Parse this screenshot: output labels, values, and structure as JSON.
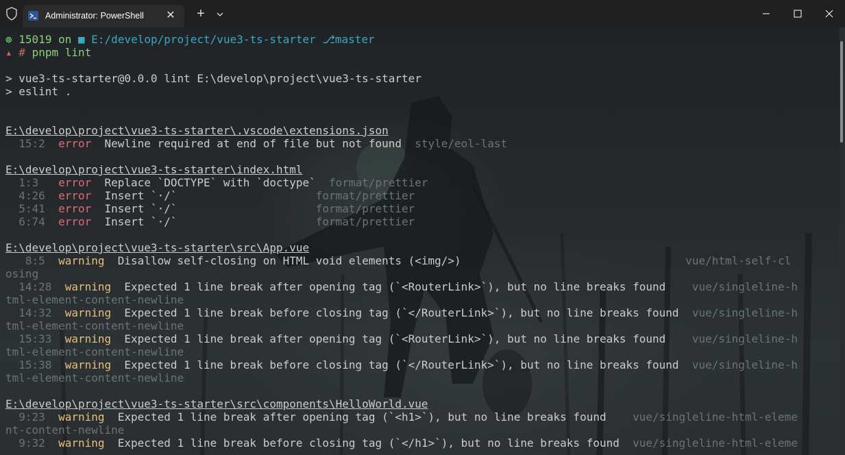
{
  "window": {
    "tab_title": "Administrator: PowerShell",
    "new_tab_label": "+",
    "close_tab_label": "✕"
  },
  "prompt": {
    "user_icon": "⊚",
    "number": "15019",
    "on": "on",
    "folder_icon": "folder-icon",
    "path": "E:/develop/project/vue3-ts-starter",
    "branch_icon": "git-branch-icon",
    "branch": "master",
    "status_icon": "▴",
    "hash": "#",
    "command": "pnpm lint"
  },
  "output": {
    "script_line": "> vue3-ts-starter@0.0.0 lint E:\\develop\\project\\vue3-ts-starter",
    "eslint_line": "> eslint ."
  },
  "files": [
    {
      "path": "E:\\develop\\project\\vue3-ts-starter\\.vscode\\extensions.json",
      "issues": [
        {
          "pos": "15:2",
          "level": "error",
          "message": "Newline required at end of file but not found",
          "rule": "style/eol-last"
        }
      ]
    },
    {
      "path": "E:\\develop\\project\\vue3-ts-starter\\index.html",
      "issues": [
        {
          "pos": "1:3",
          "level": "error",
          "message": "Replace `DOCTYPE` with `doctype`",
          "rule": "format/prettier"
        },
        {
          "pos": "4:26",
          "level": "error",
          "message": "Insert `·/`",
          "rule": "format/prettier"
        },
        {
          "pos": "5:41",
          "level": "error",
          "message": "Insert `·/`",
          "rule": "format/prettier"
        },
        {
          "pos": "6:74",
          "level": "error",
          "message": "Insert `·/`",
          "rule": "format/prettier"
        }
      ]
    },
    {
      "path": "E:\\develop\\project\\vue3-ts-starter\\src\\App.vue",
      "issues": [
        {
          "pos": "8:5",
          "level": "warning",
          "message": "Disallow self-closing on HTML void elements (<img/>)",
          "rule": "vue/html-self-cl",
          "rule_wrap": "osing"
        },
        {
          "pos": "14:28",
          "level": "warning",
          "message": "Expected 1 line break after opening tag (`<RouterLink>`), but no line breaks found",
          "rule": "vue/singleline-h",
          "rule_wrap": "tml-element-content-newline"
        },
        {
          "pos": "14:32",
          "level": "warning",
          "message": "Expected 1 line break before closing tag (`</RouterLink>`), but no line breaks found",
          "rule": "vue/singleline-h",
          "rule_wrap": "tml-element-content-newline"
        },
        {
          "pos": "15:33",
          "level": "warning",
          "message": "Expected 1 line break after opening tag (`<RouterLink>`), but no line breaks found",
          "rule": "vue/singleline-h",
          "rule_wrap": "tml-element-content-newline"
        },
        {
          "pos": "15:38",
          "level": "warning",
          "message": "Expected 1 line break before closing tag (`</RouterLink>`), but no line breaks found",
          "rule": "vue/singleline-h",
          "rule_wrap": "tml-element-content-newline"
        }
      ]
    },
    {
      "path": "E:\\develop\\project\\vue3-ts-starter\\src\\components\\HelloWorld.vue",
      "issues": [
        {
          "pos": "9:23",
          "level": "warning",
          "message": "Expected 1 line break after opening tag (`<h1>`), but no line breaks found",
          "rule": "vue/singleline-html-eleme",
          "rule_wrap": "nt-content-newline"
        },
        {
          "pos": "9:32",
          "level": "warning",
          "message": "Expected 1 line break before closing tag (`</h1>`), but no line breaks found",
          "rule": "vue/singleline-html-eleme"
        }
      ]
    }
  ]
}
